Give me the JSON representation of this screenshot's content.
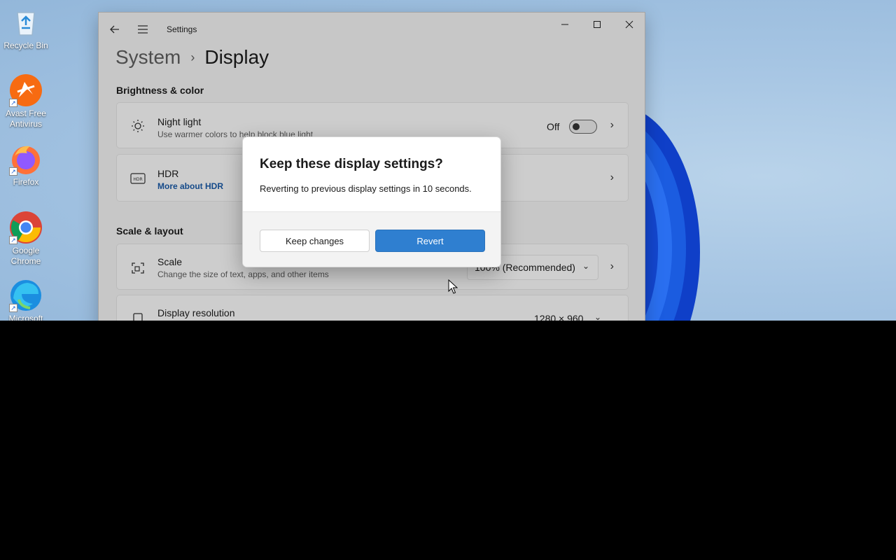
{
  "desktop": {
    "icons": [
      {
        "label": "Recycle Bin",
        "icon": "recycle-bin-icon"
      },
      {
        "label": "Avast Free Antivirus",
        "icon": "avast-icon"
      },
      {
        "label": "Firefox",
        "icon": "firefox-icon"
      },
      {
        "label": "Google Chrome",
        "icon": "chrome-icon"
      },
      {
        "label": "Microsoft",
        "icon": "edge-icon"
      }
    ]
  },
  "window": {
    "app_title": "Settings",
    "breadcrumb": {
      "parent": "System",
      "current": "Display"
    },
    "sections": {
      "brightness": "Brightness & color",
      "scale_layout": "Scale & layout"
    },
    "night_light": {
      "title": "Night light",
      "subtitle": "Use warmer colors to help block blue light",
      "state": "Off"
    },
    "hdr": {
      "title": "HDR",
      "link": "More about HDR"
    },
    "scale": {
      "title": "Scale",
      "subtitle": "Change the size of text, apps, and other items",
      "value": "100% (Recommended)"
    },
    "resolution": {
      "title": "Display resolution",
      "value": "1280 × 960"
    }
  },
  "dialog": {
    "title": "Keep these display settings?",
    "body": "Reverting to previous display settings in 10 seconds.",
    "keep_label": "Keep changes",
    "revert_label": "Revert"
  },
  "colors": {
    "accent": "#2f7fd0",
    "wallpaper": "#a6c5e3"
  }
}
